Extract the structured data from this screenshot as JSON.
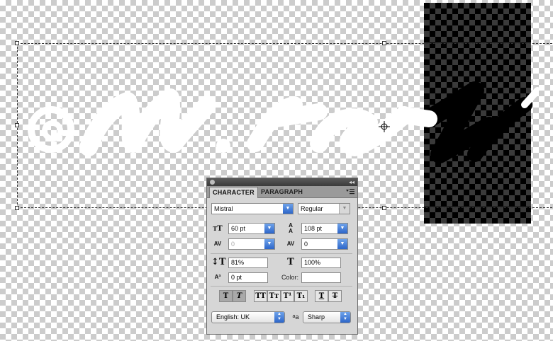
{
  "canvas": {
    "text_layer": "@m.acaz",
    "dark_block_color": "#000000"
  },
  "panel": {
    "tabs": [
      {
        "label": "CHARACTER",
        "active": true
      },
      {
        "label": "PARAGRAPH",
        "active": false
      }
    ],
    "font_family": "Mistral",
    "font_style": "Regular",
    "font_size": "60 pt",
    "leading": "108 pt",
    "kerning": "0",
    "tracking": "0",
    "vertical_scale": "81%",
    "horizontal_scale": "100%",
    "baseline_shift": "0 pt",
    "color_label": "Color:",
    "format_buttons": [
      {
        "label": "T",
        "name": "faux-bold-button"
      },
      {
        "label": "T",
        "name": "faux-italic-button"
      },
      {
        "label": "TT",
        "name": "all-caps-button"
      },
      {
        "label": "Tт",
        "name": "small-caps-button"
      },
      {
        "label": "T¹",
        "name": "superscript-button"
      },
      {
        "label": "T₁",
        "name": "subscript-button"
      },
      {
        "label": "T",
        "name": "underline-button"
      },
      {
        "label": "T",
        "name": "strikethrough-button"
      }
    ],
    "language": "English: UK",
    "aa_label": "a",
    "antialias": "Sharp",
    "accent_color": "#2d66c9"
  }
}
